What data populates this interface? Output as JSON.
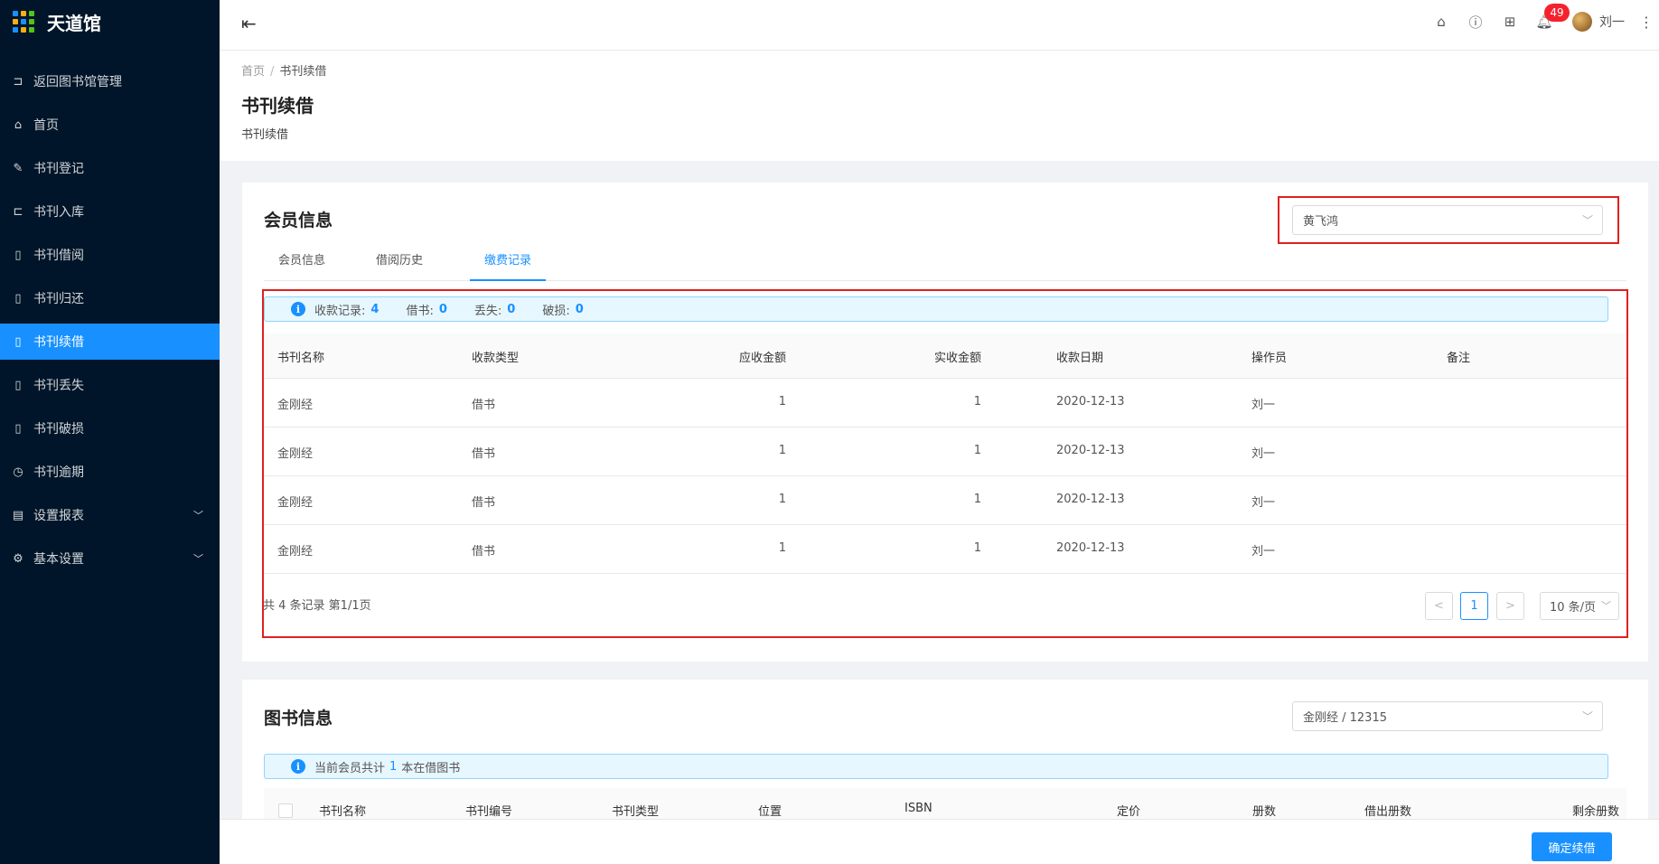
{
  "app": {
    "title": "天道馆"
  },
  "sidebar": {
    "items": [
      {
        "label": "返回图书馆管理",
        "icon": "exit-icon",
        "glyph": "⊐",
        "active": false
      },
      {
        "label": "首页",
        "icon": "home-icon",
        "glyph": "⌂",
        "active": false
      },
      {
        "label": "书刊登记",
        "icon": "pen-icon",
        "glyph": "✎",
        "active": false
      },
      {
        "label": "书刊入库",
        "icon": "import-icon",
        "glyph": "⊏",
        "active": false
      },
      {
        "label": "书刊借阅",
        "icon": "book-icon",
        "glyph": "▯",
        "active": false
      },
      {
        "label": "书刊归还",
        "icon": "book-icon",
        "glyph": "▯",
        "active": false
      },
      {
        "label": "书刊续借",
        "icon": "book-icon",
        "glyph": "▯",
        "active": true
      },
      {
        "label": "书刊丢失",
        "icon": "book-icon",
        "glyph": "▯",
        "active": false
      },
      {
        "label": "书刊破损",
        "icon": "book-icon",
        "glyph": "▯",
        "active": false
      },
      {
        "label": "书刊逾期",
        "icon": "clock-icon",
        "glyph": "◷",
        "active": false
      },
      {
        "label": "设置报表",
        "icon": "report-icon",
        "glyph": "▤",
        "active": false,
        "submenu": true
      },
      {
        "label": "基本设置",
        "icon": "gear-icon",
        "glyph": "⚙",
        "active": false,
        "submenu": true
      }
    ]
  },
  "topbar": {
    "notification_count": "49",
    "user_name": "刘一"
  },
  "header": {
    "breadcrumb_home": "首页",
    "breadcrumb_sep": "/",
    "breadcrumb_current": "书刊续借",
    "title": "书刊续借",
    "description": "书刊续借"
  },
  "member": {
    "title": "会员信息",
    "selected_member": "黄飞鸿",
    "tabs": [
      "会员信息",
      "借阅历史",
      "缴费记录"
    ],
    "active_tab": 2,
    "summary": {
      "records_label": "收款记录:",
      "records_value": "4",
      "borrow_label": "借书:",
      "borrow_value": "0",
      "lost_label": "丢失:",
      "lost_value": "0",
      "damaged_label": "破损:",
      "damaged_value": "0"
    },
    "columns": [
      "书刊名称",
      "收款类型",
      "应收金额",
      "实收金额",
      "收款日期",
      "操作员",
      "备注"
    ],
    "rows": [
      [
        "金刚经",
        "借书",
        "1",
        "1",
        "2020-12-13",
        "刘一",
        ""
      ],
      [
        "金刚经",
        "借书",
        "1",
        "1",
        "2020-12-13",
        "刘一",
        ""
      ],
      [
        "金刚经",
        "借书",
        "1",
        "1",
        "2020-12-13",
        "刘一",
        ""
      ],
      [
        "金刚经",
        "借书",
        "1",
        "1",
        "2020-12-13",
        "刘一",
        ""
      ]
    ],
    "pager": {
      "summary": "共 4 条记录 第1/1页",
      "prev": "<",
      "current": "1",
      "next": ">",
      "page_size": "10 条/页"
    }
  },
  "book": {
    "title": "图书信息",
    "selected_book": "金刚经 / 12315",
    "notice_prefix": "当前会员共计",
    "notice_count": "1",
    "notice_suffix": "本在借图书",
    "columns": [
      "书刊名称",
      "书刊编号",
      "书刊类型",
      "位置",
      "ISBN",
      "定价",
      "册数",
      "借出册数",
      "剩余册数"
    ]
  },
  "footer": {
    "confirm_label": "确定续借"
  }
}
